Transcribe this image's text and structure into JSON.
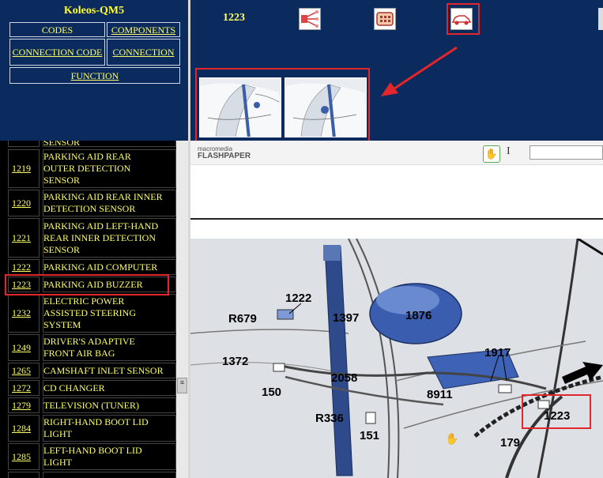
{
  "app_title": "Koleos-QM5",
  "nav": {
    "codes": "CODES",
    "components": "COMPONENTS",
    "connection_code": "CONNECTION CODE",
    "connection": "CONNECTION",
    "function": "FUNCTION"
  },
  "header": {
    "selected_code": "1223",
    "icons": [
      "wiring-harness-icon",
      "connector-icon",
      "vehicle-location-icon"
    ]
  },
  "list_items": [
    {
      "code": "",
      "label": "SENSOR"
    },
    {
      "code": "1219",
      "label": "PARKING AID REAR\nOUTER DETECTION\nSENSOR"
    },
    {
      "code": "1220",
      "label": "PARKING AID REAR INNER\nDETECTION SENSOR"
    },
    {
      "code": "1221",
      "label": "PARKING AID LEFT-HAND\nREAR INNER DETECTION\nSENSOR"
    },
    {
      "code": "1222",
      "label": "PARKING AID COMPUTER"
    },
    {
      "code": "1223",
      "label": "PARKING AID BUZZER"
    },
    {
      "code": "1232",
      "label": "ELECTRIC POWER\nASSISTED STEERING\nSYSTEM"
    },
    {
      "code": "1249",
      "label": "DRIVER'S ADAPTIVE\nFRONT AIR BAG"
    },
    {
      "code": "1265",
      "label": "CAMSHAFT INLET SENSOR"
    },
    {
      "code": "1272",
      "label": "CD CHANGER"
    },
    {
      "code": "1279",
      "label": "TELEVISION (TUNER)"
    },
    {
      "code": "1284",
      "label": "RIGHT-HAND BOOT LID\nLIGHT"
    },
    {
      "code": "1285",
      "label": "LEFT-HAND BOOT LID\nLIGHT"
    }
  ],
  "viewer": {
    "logo_line1": "macromedia",
    "logo_line2": "FLASHPAPER"
  },
  "diagram_labels": [
    "1222",
    "R679",
    "1397",
    "1876",
    "1372",
    "1917",
    "2058",
    "150",
    "8911",
    "R336",
    "151",
    "1223",
    "179"
  ],
  "colors": {
    "navy": "#0b2a5e",
    "highlight": "#e3262b",
    "text_yellow": "#ffff66"
  }
}
